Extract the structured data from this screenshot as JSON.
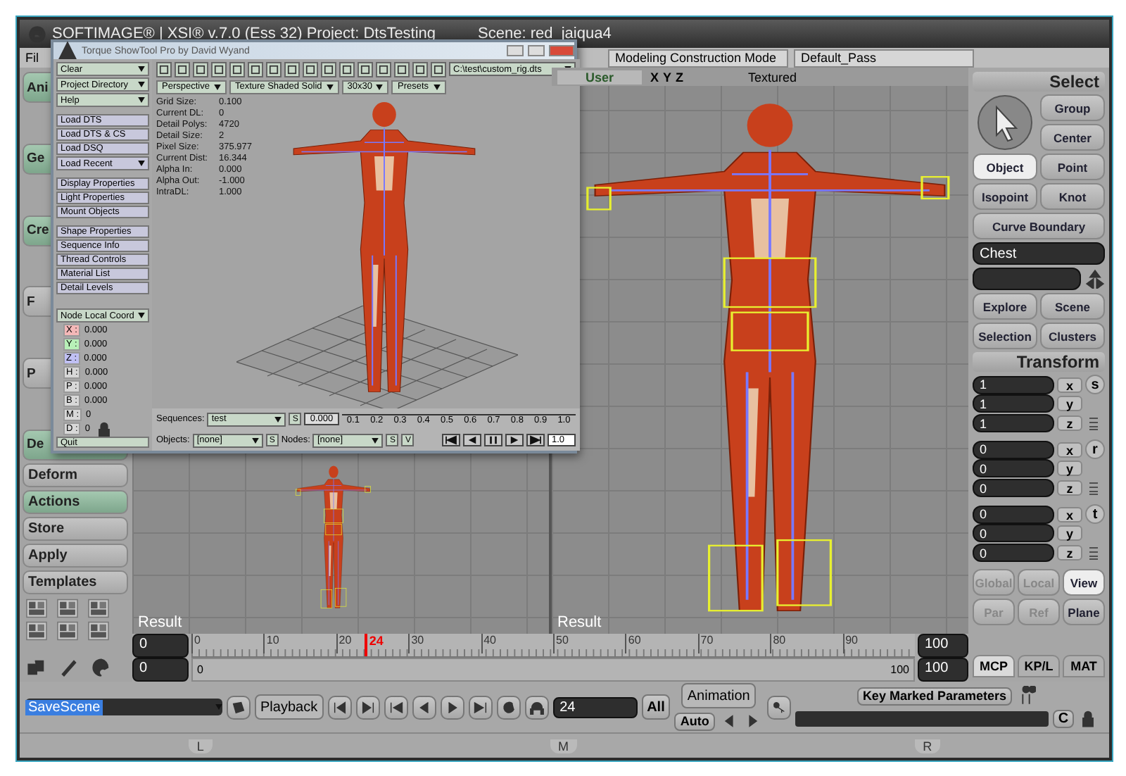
{
  "window": {
    "title": "SOFTIMAGE® | XSI® v.7.0 (Ess 32) Project: DtsTesting",
    "scene": "Scene: red_jaiqua4"
  },
  "menu": [
    "Fil"
  ],
  "toolbar": {
    "mode": "Modeling Construction Mode",
    "pass": "Default_Pass"
  },
  "left_panel": {
    "buttons": [
      {
        "label": "Ani",
        "selected": true
      },
      {
        "label": "Ge",
        "selected": true
      },
      {
        "label": "Cre",
        "selected": true
      },
      {
        "label": "F",
        "selected": false
      },
      {
        "label": "P",
        "selected": false
      },
      {
        "label": "De",
        "selected": true
      },
      {
        "label": "Deform",
        "selected": false
      },
      {
        "label": "Actions",
        "selected": true
      },
      {
        "label": "Store",
        "selected": false
      },
      {
        "label": "Apply",
        "selected": false
      },
      {
        "label": "Templates",
        "selected": false
      }
    ]
  },
  "viewports": [
    {
      "label": "Result"
    },
    {
      "camera": "User",
      "axes": [
        "X",
        "Y",
        "Z"
      ],
      "display": "Textured",
      "label": "Result"
    }
  ],
  "select_panel": {
    "title": "Select",
    "buttons": [
      {
        "label": "Group",
        "selected": false
      },
      {
        "label": "Center",
        "selected": false
      },
      {
        "label": "Object",
        "selected": true
      },
      {
        "label": "Point",
        "selected": false
      },
      {
        "label": "Isopoint",
        "selected": false
      },
      {
        "label": "Knot",
        "selected": false
      },
      {
        "label": "Curve Boundary",
        "selected": false
      }
    ],
    "object_name": "Chest",
    "browse_buttons": [
      "Explore",
      "Scene",
      "Selection",
      "Clusters"
    ]
  },
  "transform_panel": {
    "title": "Transform",
    "groups": [
      {
        "label": "s",
        "rows": [
          {
            "value": "1",
            "axis": "x"
          },
          {
            "value": "1",
            "axis": "y"
          },
          {
            "value": "1",
            "axis": "z"
          }
        ]
      },
      {
        "label": "r",
        "rows": [
          {
            "value": "0",
            "axis": "x"
          },
          {
            "value": "0",
            "axis": "y"
          },
          {
            "value": "0",
            "axis": "z"
          }
        ]
      },
      {
        "label": "t",
        "rows": [
          {
            "value": "0",
            "axis": "x"
          },
          {
            "value": "0",
            "axis": "y"
          },
          {
            "value": "0",
            "axis": "z"
          }
        ]
      }
    ],
    "spaces": [
      {
        "label": "Global",
        "selected": false,
        "disabled": true
      },
      {
        "label": "Local",
        "selected": false,
        "disabled": true
      },
      {
        "label": "View",
        "selected": true,
        "disabled": false
      },
      {
        "label": "Par",
        "selected": false,
        "disabled": true
      },
      {
        "label": "Ref",
        "selected": false,
        "disabled": true
      },
      {
        "label": "Plane",
        "selected": false,
        "disabled": false
      }
    ]
  },
  "panel_tabs": [
    {
      "label": "MCP",
      "selected": true
    },
    {
      "label": "KP/L",
      "selected": false
    },
    {
      "label": "MAT",
      "selected": false
    }
  ],
  "timeline": {
    "start": "0",
    "range_start": "0",
    "ruler_labels": [
      "0",
      "10",
      "20",
      "30",
      "40",
      "50",
      "60",
      "70",
      "80",
      "90"
    ],
    "current_frame": "24",
    "range_start_label": "0",
    "range_end_label": "100",
    "end": "100",
    "range_end": "100"
  },
  "command_bar": {
    "command": "SaveScene",
    "playback": "Playback",
    "frame": "24",
    "all": "All",
    "animation": "Animation",
    "auto": "Auto",
    "key_label": "Key Marked Parameters",
    "c_label": "C"
  },
  "footer": [
    "L",
    "M",
    "R"
  ],
  "showtool": {
    "title": "Torque ShowTool Pro by David Wyand",
    "dropdowns": [
      "Clear",
      "Project Directory",
      "Help"
    ],
    "load_buttons": [
      {
        "label": "Load DTS",
        "kind": "button"
      },
      {
        "label": "Load DTS & CS",
        "kind": "button"
      },
      {
        "label": "Load DSQ",
        "kind": "button"
      },
      {
        "label": "Load Recent",
        "kind": "dropdown"
      }
    ],
    "property_buttons": [
      "Display Properties",
      "Light Properties",
      "Mount Objects"
    ],
    "info_buttons": [
      "Shape Properties",
      "Sequence Info",
      "Thread Controls",
      "Material List",
      "Detail Levels"
    ],
    "coord_mode": "Node Local Coord",
    "coords": [
      {
        "label": "X :",
        "value": "0.000",
        "color": "#f4b8b8"
      },
      {
        "label": "Y :",
        "value": "0.000",
        "color": "#b8f0b8"
      },
      {
        "label": "Z :",
        "value": "0.000",
        "color": "#c0c0f4"
      },
      {
        "label": "H :",
        "value": "0.000",
        "color": "#d8d8d8"
      },
      {
        "label": "P :",
        "value": "0.000",
        "color": "#d8d8d8"
      },
      {
        "label": "B :",
        "value": "0.000",
        "color": "#d8d8d8"
      },
      {
        "label": "M :",
        "value": "0",
        "color": "#d8d8d8"
      },
      {
        "label": "D :",
        "value": "0",
        "color": "#d8d8d8"
      }
    ],
    "quit": "Quit",
    "path": "C:\\test\\custom_rig.dts",
    "view_dropdowns": [
      "Perspective",
      "Texture Shaded Solid",
      "30x30",
      "Presets"
    ],
    "stats": [
      {
        "label": "Grid Size:",
        "value": "0.100"
      },
      {
        "label": "Current DL:",
        "value": "0"
      },
      {
        "label": "Detail Polys:",
        "value": "4720"
      },
      {
        "label": "Detail Size:",
        "value": "2"
      },
      {
        "label": "Pixel Size:",
        "value": "375.977"
      },
      {
        "label": "Current Dist:",
        "value": "16.344"
      },
      {
        "label": "Alpha In:",
        "value": "0.000"
      },
      {
        "label": "Alpha Out:",
        "value": "-1.000"
      },
      {
        "label": "IntraDL:",
        "value": "1.000"
      }
    ],
    "sequences_label": "Sequences:",
    "sequence": "test",
    "s_label": "S",
    "slider_value": "0.000",
    "slider_ticks": [
      "0.1",
      "0.2",
      "0.3",
      "0.4",
      "0.5",
      "0.6",
      "0.7",
      "0.8",
      "0.9",
      "1.0"
    ],
    "objects_label": "Objects:",
    "object": "[none]",
    "objects_s": "S",
    "nodes_label": "Nodes:",
    "node": "[none]",
    "nodes_s": "S",
    "nodes_v": "V",
    "speed": "1.0"
  }
}
